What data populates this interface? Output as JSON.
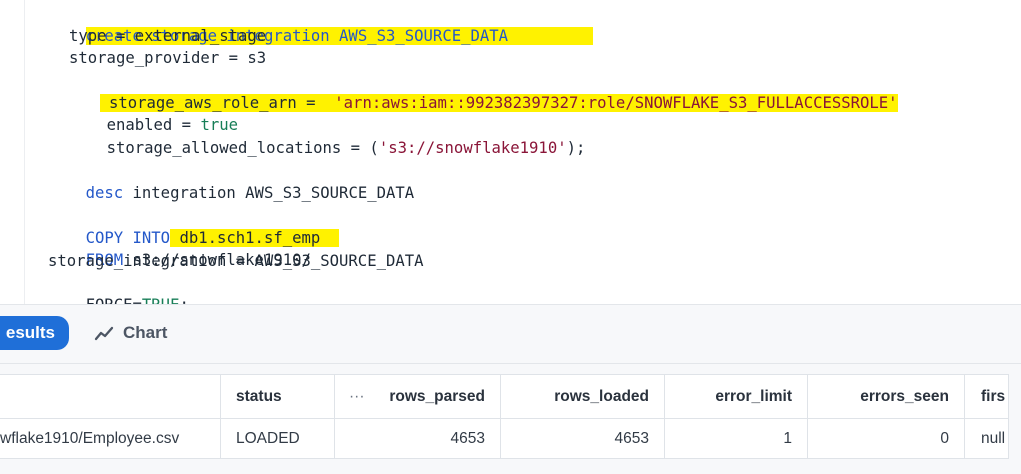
{
  "editor": {
    "lines": {
      "l1": "create storage integration AWS_S3_SOURCE_DATA",
      "l2": "type = external_stage",
      "l3": "storage_provider = s3",
      "l4_prefix": "storage_aws_role_arn = ",
      "l4_value": "'arn:aws:iam::992382397327:role/SNOWFLAKE_S3_FULLACCESSROLE'",
      "l5_prefix": "enabled = ",
      "l5_value": "true",
      "l6_prefix": "storage_allowed_locations = (",
      "l6_value": "'s3://snowflake1910'",
      "l6_suffix": ");",
      "l7_kw": "desc",
      "l7_rest": " integration AWS_S3_SOURCE_DATA",
      "l8_kw": "COPY INTO",
      "l8_rest": " db1.sch1.sf_emp",
      "l9_kw": "FROM",
      "l9_rest": " s3://snowflake1910/",
      "l10": "storage_integration = AWS_S3_SOURCE_DATA",
      "l11_prefix": "FORCE=",
      "l11_value": "TRUE",
      "l11_suffix": ";"
    }
  },
  "results": {
    "tabs": {
      "results_label": "esults",
      "chart_label": "Chart"
    },
    "table": {
      "headers": {
        "status": "status",
        "dots": "···",
        "rows_parsed": "rows_parsed",
        "rows_loaded": "rows_loaded",
        "error_limit": "error_limit",
        "errors_seen": "errors_seen",
        "first": "firs"
      },
      "row": {
        "file": "wflake1910/Employee.csv",
        "status": "LOADED",
        "rows_parsed": "4653",
        "rows_loaded": "4653",
        "error_limit": "1",
        "errors_seen": "0",
        "first": "null"
      }
    }
  },
  "colors": {
    "highlight": "#fff200",
    "keyword": "#2458c9",
    "string": "#8a1538",
    "boolean": "#177e57",
    "results_button": "#1f6fd8"
  },
  "icons": {
    "chart": "trend-line-icon"
  }
}
